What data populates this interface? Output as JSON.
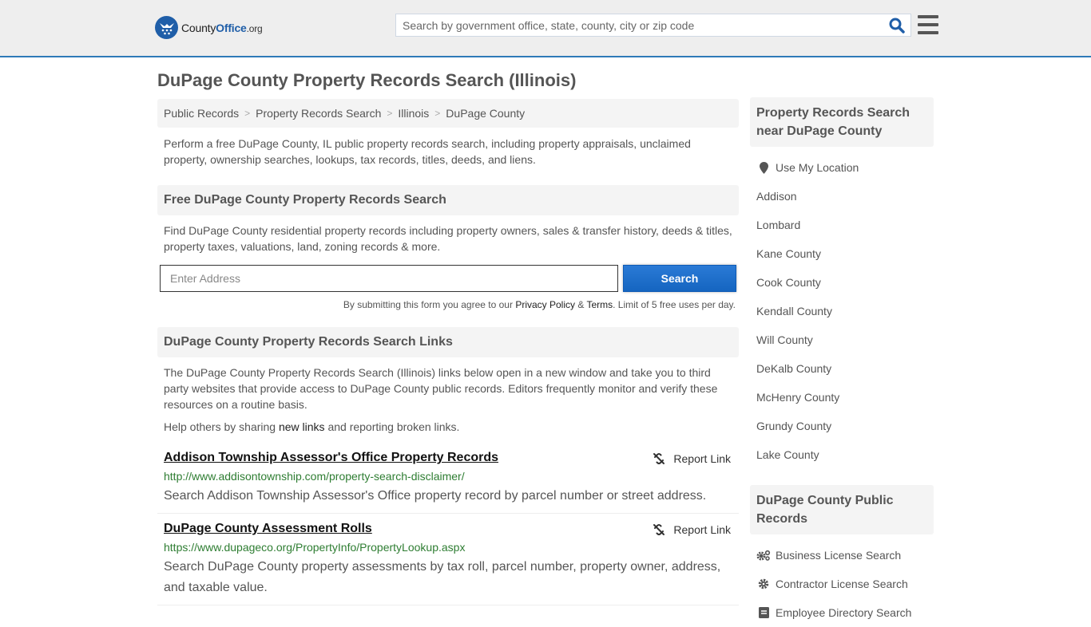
{
  "header": {
    "logo": {
      "name": "County",
      "name_bold": "Office",
      "tld": ".org"
    },
    "search": {
      "placeholder": "Search by government office, state, county, city or zip code"
    },
    "colors": {
      "accent": "#2f7ab8",
      "brand": "#1f5ea8"
    }
  },
  "page": {
    "title": "DuPage County Property Records Search (Illinois)"
  },
  "breadcrumb": [
    {
      "label": "Public Records"
    },
    {
      "label": "Property Records Search"
    },
    {
      "label": "Illinois"
    },
    {
      "label": "DuPage County"
    }
  ],
  "intro": "Perform a free DuPage County, IL public property records search, including property appraisals, unclaimed property, ownership searches, lookups, tax records, titles, deeds, and liens.",
  "free_search": {
    "heading": "Free DuPage County Property Records Search",
    "text": "Find DuPage County residential property records including property owners, sales & transfer history, deeds & titles, property taxes, valuations, land, zoning records & more.",
    "address_placeholder": "Enter Address",
    "button_label": "Search",
    "note_prefix": "By submitting this form you agree to our ",
    "privacy_label": "Privacy Policy",
    "amp": " & ",
    "terms_label": "Terms",
    "note_suffix": ". Limit of 5 free uses per day."
  },
  "links_section": {
    "heading": "DuPage County Property Records Search Links",
    "text": "The DuPage County Property Records Search (Illinois) links below open in a new window and take you to third party websites that provide access to DuPage County public records. Editors frequently monitor and verify these resources on a routine basis.",
    "help_prefix": "Help others by sharing ",
    "help_link": "new links",
    "help_suffix": " and reporting broken links.",
    "report_label": "Report Link",
    "items": [
      {
        "title": "Addison Township Assessor's Office Property Records",
        "url": "http://www.addisontownship.com/property-search-disclaimer/",
        "desc": "Search Addison Township Assessor's Office property record by parcel number or street address."
      },
      {
        "title": "DuPage County Assessment Rolls",
        "url": "https://www.dupageco.org/PropertyInfo/PropertyLookup.aspx",
        "desc": "Search DuPage County property assessments by tax roll, parcel number, property owner, address, and taxable value."
      }
    ]
  },
  "sidebar": {
    "nearby": {
      "heading": "Property Records Search near DuPage County",
      "use_location": "Use My Location",
      "items": [
        "Addison",
        "Lombard",
        "Kane County",
        "Cook County",
        "Kendall County",
        "Will County",
        "DeKalb County",
        "McHenry County",
        "Grundy County",
        "Lake County"
      ]
    },
    "public_records": {
      "heading": "DuPage County Public Records",
      "items": [
        {
          "label": "Business License Search",
          "icon": "gears-icon"
        },
        {
          "label": "Contractor License Search",
          "icon": "gear-icon"
        },
        {
          "label": "Employee Directory Search",
          "icon": "address-book-icon"
        }
      ]
    }
  }
}
